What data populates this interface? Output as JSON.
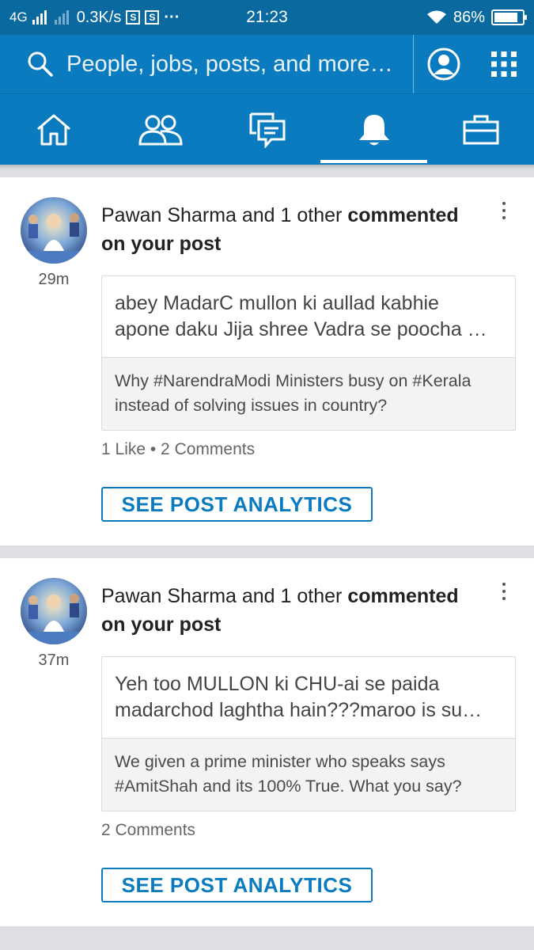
{
  "status_bar": {
    "network": "4G",
    "speed": "0.3K/s",
    "sim_badge": "S",
    "dots": "···",
    "time": "21:23",
    "battery_percent": "86%",
    "battery_level": 0.86
  },
  "search": {
    "placeholder": "People, jobs, posts, and more…"
  },
  "tabs": [
    {
      "icon": "home-icon"
    },
    {
      "icon": "my-network-icon"
    },
    {
      "icon": "messaging-icon"
    },
    {
      "icon": "notifications-icon",
      "active": true
    },
    {
      "icon": "jobs-icon"
    }
  ],
  "notifications": [
    {
      "actor": "Pawan Sharma and 1 other",
      "action_line1": "commented",
      "action_line2": "on your post",
      "time": "29m",
      "comment_line1": "abey MadarC  mullon ki aullad kabhie",
      "comment_line2": "apone daku Jija shree Vadra se poocha …",
      "shared_line1": "Why #NarendraModi Ministers busy on #Kerala",
      "shared_line2": "instead of solving issues in country?",
      "stats": "1 Like • 2 Comments",
      "button": "SEE POST ANALYTICS"
    },
    {
      "actor": "Pawan Sharma and 1 other",
      "action_line1": "commented",
      "action_line2": "on your post",
      "time": "37m",
      "comment_line1": "Yeh too MULLON ki CHU-ai se paida",
      "comment_line2": "madarchod laghtha hain???maroo is su…",
      "shared_line1": "We given a prime minister who speaks says",
      "shared_line2": "#AmitShah and its 100% True. What you say?",
      "stats": "2 Comments",
      "button": "SEE POST ANALYTICS"
    }
  ],
  "colors": {
    "status_bar": "#0a6aa0",
    "brand": "#0a7bbf",
    "card_bg": "#ffffff",
    "page_bg": "#dddfe2"
  }
}
